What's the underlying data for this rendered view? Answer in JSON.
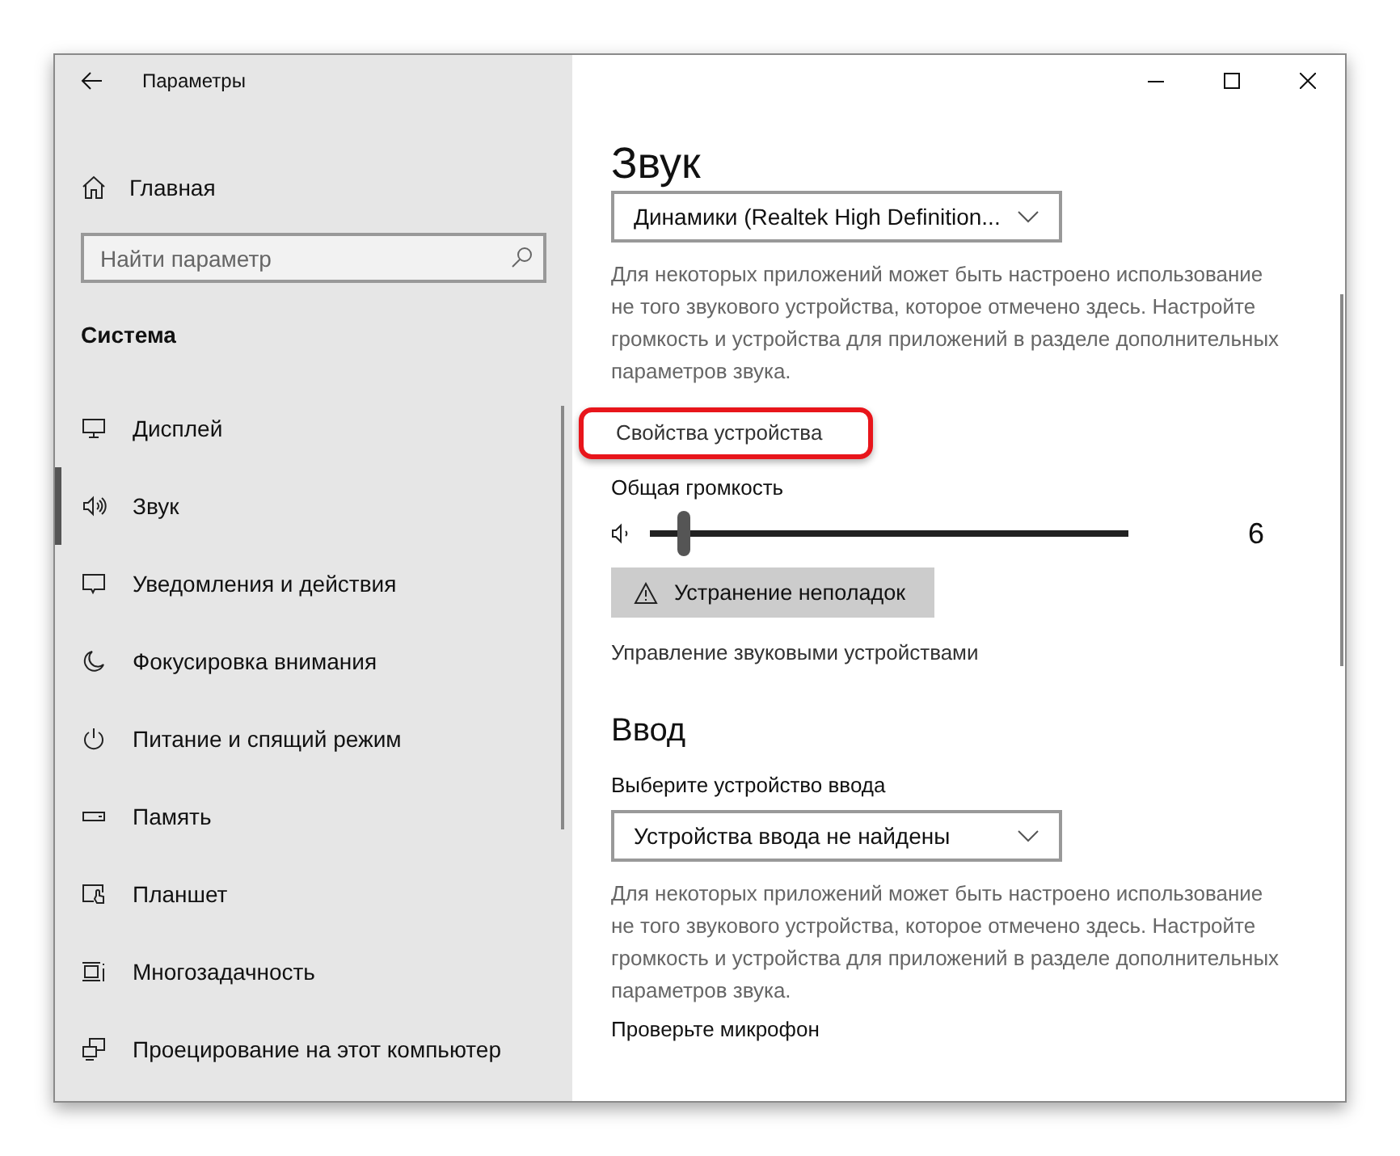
{
  "window": {
    "title": "Параметры"
  },
  "sidebar": {
    "home": "Главная",
    "search": {
      "placeholder": "Найти параметр"
    },
    "section": "Система",
    "items": [
      {
        "label": "Дисплей",
        "selected": false
      },
      {
        "label": "Звук",
        "selected": true
      },
      {
        "label": "Уведомления и действия",
        "selected": false
      },
      {
        "label": "Фокусировка внимания",
        "selected": false
      },
      {
        "label": "Питание и спящий режим",
        "selected": false
      },
      {
        "label": "Память",
        "selected": false
      },
      {
        "label": "Планшет",
        "selected": false
      },
      {
        "label": "Многозадачность",
        "selected": false
      },
      {
        "label": "Проецирование на этот компьютер",
        "selected": false
      }
    ]
  },
  "content": {
    "title": "Звук",
    "output": {
      "device": "Динамики (Realtek High Definition...",
      "note": "Для некоторых приложений может быть настроено использование не того звукового устройства, которое отмечено здесь. Настройте громкость и устройства для приложений в разделе дополнительных параметров звука.",
      "properties_link": "Свойства устройства",
      "volume_label": "Общая громкость",
      "volume": {
        "level": 0.07,
        "reading": "6"
      },
      "troubleshoot": "Устранение неполадок",
      "manage_link": "Управление звуковыми устройствами"
    },
    "input": {
      "title": "Ввод",
      "label": "Выберите устройство ввода",
      "device": "Устройства ввода не найдены",
      "note": "Для некоторых приложений может быть настроено использование не того звукового устройства, которое отмечено здесь. Настройте громкость и устройства для приложений в разделе дополнительных параметров звука.",
      "test_label": "Проверьте микрофон"
    }
  }
}
